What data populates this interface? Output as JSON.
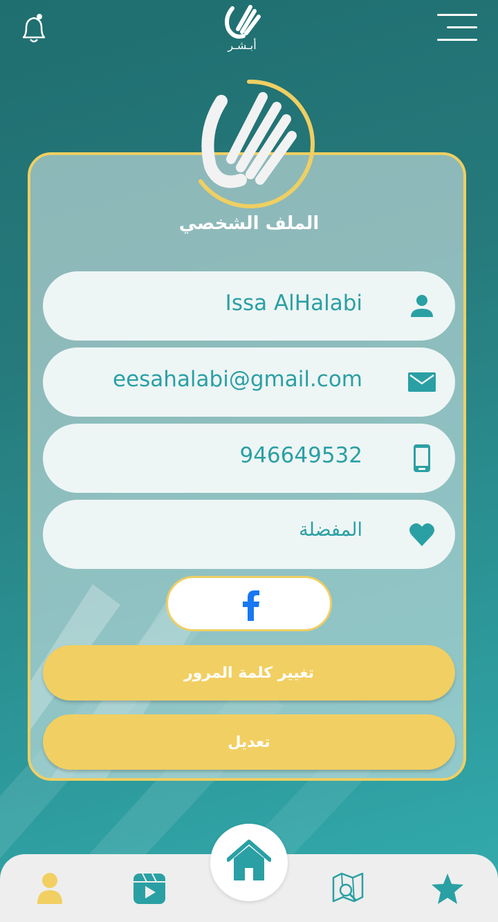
{
  "header": {
    "brand_text": "أبـشـر",
    "bell_icon": "bell-icon",
    "menu_icon": "hamburger-menu-icon"
  },
  "profile": {
    "title": "الملف الشخصي",
    "fields": [
      {
        "name": "name-field",
        "icon": "person-icon",
        "value": "Issa AlHalabi"
      },
      {
        "name": "email-field",
        "icon": "envelope-icon",
        "value": "eesahalabi@gmail.com"
      },
      {
        "name": "phone-field",
        "icon": "mobile-phone-icon",
        "value": "946649532"
      },
      {
        "name": "favorites-field",
        "icon": "heart-icon",
        "value": "المفضلة"
      }
    ],
    "facebook_icon": "facebook-icon",
    "change_password_label": "تغيير كلمة المرور",
    "edit_label": "تعديل"
  },
  "bottom_nav": {
    "items": [
      "profile-icon",
      "video-icon",
      "home-icon",
      "map-search-icon",
      "star-icon"
    ],
    "active": "profile-icon"
  },
  "colors": {
    "teal": "#2aa0a4",
    "accent_yellow": "#f1cf62",
    "field_bg": "#eef5f5"
  }
}
